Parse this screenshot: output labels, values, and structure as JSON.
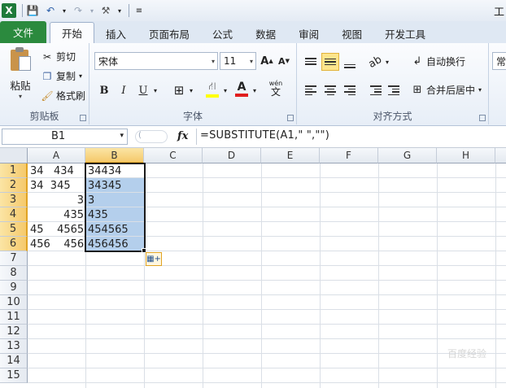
{
  "app": {
    "title_partial": "工"
  },
  "quick_access": {
    "icons": [
      "excel-logo",
      "save",
      "undo",
      "redo",
      "tools",
      "customize"
    ]
  },
  "tabs": [
    "文件",
    "开始",
    "插入",
    "页面布局",
    "公式",
    "数据",
    "审阅",
    "视图",
    "开发工具"
  ],
  "active_tab": "开始",
  "ribbon": {
    "clipboard": {
      "paste_label": "粘贴",
      "cut_label": "剪切",
      "copy_label": "复制",
      "format_painter_label": "格式刷",
      "group_label": "剪贴板"
    },
    "font": {
      "font_name": "宋体",
      "font_size": "11",
      "bold": "B",
      "italic": "I",
      "underline": "U",
      "phonetic": "wén",
      "group_label": "字体"
    },
    "alignment": {
      "wrap_text_label": "自动换行",
      "merge_center_label": "合并后居中",
      "group_label": "对齐方式"
    },
    "number": {
      "format_partial": "常"
    }
  },
  "formula_bar": {
    "name_box": "B1",
    "fx_label": "fx",
    "formula": "=SUBSTITUTE(A1,\" \",\"\")"
  },
  "sheet": {
    "columns": [
      "A",
      "B",
      "C",
      "D",
      "E",
      "F",
      "G",
      "H"
    ],
    "rows": [
      "1",
      "2",
      "3",
      "4",
      "5",
      "6",
      "7",
      "8",
      "9",
      "10",
      "11",
      "12",
      "13",
      "14",
      "15"
    ],
    "col_a": [
      "34   434",
      "34  345",
      "3",
      "435",
      "45    4565",
      "456    456"
    ],
    "col_b": [
      "34434",
      "34345",
      "3",
      "435",
      "454565",
      "456456"
    ],
    "selected_column": "B"
  },
  "watermark": "百度经验"
}
